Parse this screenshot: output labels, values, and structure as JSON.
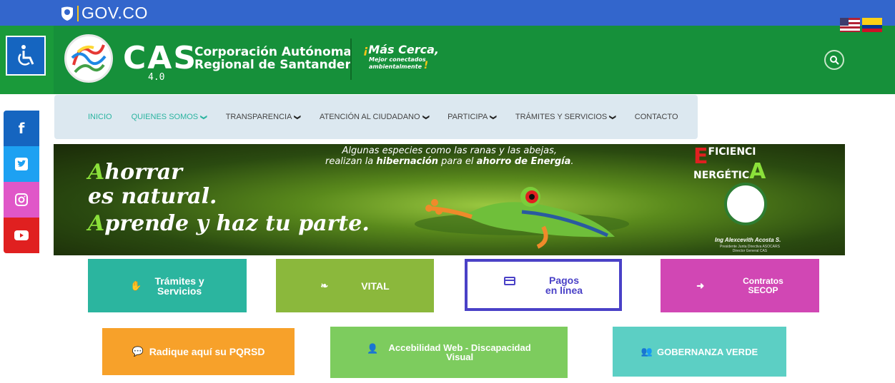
{
  "govbar": {
    "label": "GOV.CO"
  },
  "header": {
    "brand": "CAS",
    "version": "4.0",
    "name_line1": "Corporación Autónoma",
    "name_line2": "Regional de Santander",
    "slogan_main": "Más Cerca,",
    "slogan_sub1": "Mejor conectados",
    "slogan_sub2": "ambientalmente",
    "accent": "#1a9a3a"
  },
  "nav": {
    "items": [
      {
        "label": "INICIO",
        "dropdown": false
      },
      {
        "label": "QUIENES SOMOS",
        "dropdown": true
      },
      {
        "label": "TRANSPARENCIA",
        "dropdown": true
      },
      {
        "label": "ATENCIÓN AL CIUDADANO",
        "dropdown": true
      },
      {
        "label": "PARTICIPA",
        "dropdown": true
      },
      {
        "label": "TRÁMITES Y SERVICIOS",
        "dropdown": true
      },
      {
        "label": "CONTACTO",
        "dropdown": false
      }
    ]
  },
  "social": {
    "facebook": "f",
    "twitter": "t",
    "instagram": "◎",
    "youtube": "▶"
  },
  "banner": {
    "top_line1": "Algunas especies como las ranas y las abejas,",
    "top_line2_pre": "realizan la ",
    "top_line2_bold1": "hibernación",
    "top_line2_mid": " para el ",
    "top_line2_bold2": "ahorro de Energía",
    "top_line2_post": ".",
    "l1_cap": "A",
    "l1_rest": "horrar",
    "l2": "es natural.",
    "l3_cap": "A",
    "l3_rest": "prende y haz tu parte.",
    "eff_big_e": "E",
    "eff_top": "FICIENCI",
    "eff_bottom": "NERGÉTIC",
    "eff_big_a": "A",
    "signer": "Ing Alexcevith Acosta S.",
    "signer_sub1": "Presidente Junta Directiva ASOCARS",
    "signer_sub2": "Director General CAS"
  },
  "buttons": {
    "tramites_1": "Trámites y",
    "tramites_2": "Servicios",
    "vital": "VITAL",
    "pagos_1": "Pagos",
    "pagos_2": "en línea",
    "contratos_1": "Contratos",
    "contratos_2": "SECOP",
    "pqrsd": "Radique aquí su PQRSD",
    "accesibilidad_1": "Accebilidad Web - Discapacidad",
    "accesibilidad_2": "Visual",
    "gobernanza": "GOBERNANZA VERDE"
  }
}
